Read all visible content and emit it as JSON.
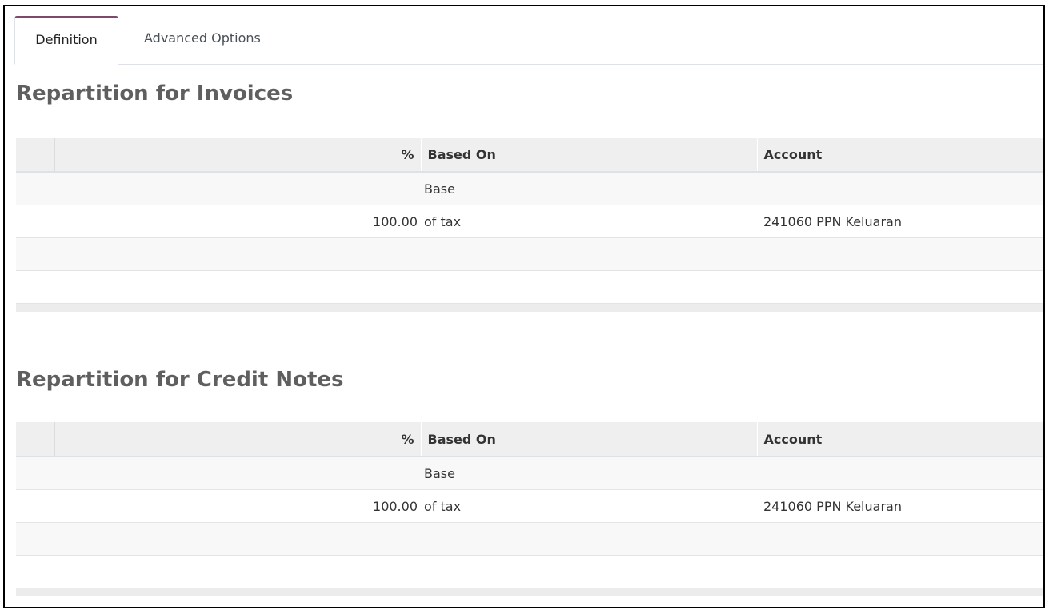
{
  "tabs": [
    {
      "label": "Definition"
    },
    {
      "label": "Advanced Options"
    }
  ],
  "invoices": {
    "title": "Repartition for Invoices",
    "columns": {
      "percent": "%",
      "based_on": "Based On",
      "account": "Account"
    },
    "rows": [
      {
        "percent": "",
        "based_on": "Base",
        "account": ""
      },
      {
        "percent": "100.00",
        "based_on": "of tax",
        "account": "241060 PPN Keluaran"
      }
    ]
  },
  "credit_notes": {
    "title": "Repartition for Credit Notes",
    "columns": {
      "percent": "%",
      "based_on": "Based On",
      "account": "Account"
    },
    "rows": [
      {
        "percent": "",
        "based_on": "Base",
        "account": ""
      },
      {
        "percent": "100.00",
        "based_on": "of tax",
        "account": "241060 PPN Keluaran"
      }
    ]
  },
  "colors": {
    "accent": "#7c4b68",
    "header_bg": "#efefef",
    "title": "#5f5f5f"
  }
}
